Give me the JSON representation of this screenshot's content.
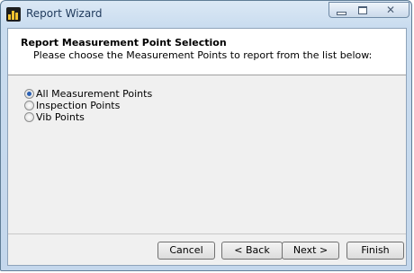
{
  "window": {
    "title": "Report Wizard",
    "close_symbol": "✕"
  },
  "header": {
    "title": "Report Measurement Point Selection",
    "subtitle": "Please choose the Measurement Points to report from the list below:"
  },
  "options": [
    {
      "label": "All Measurement Points",
      "checked": true
    },
    {
      "label": "Inspection Points",
      "checked": false
    },
    {
      "label": "Vib Points",
      "checked": false
    }
  ],
  "buttons": {
    "cancel": "Cancel",
    "back": "< Back",
    "next": "Next >",
    "finish": "Finish"
  },
  "colors": {
    "accent": "#2a60b4",
    "title_text": "#1e395b"
  }
}
